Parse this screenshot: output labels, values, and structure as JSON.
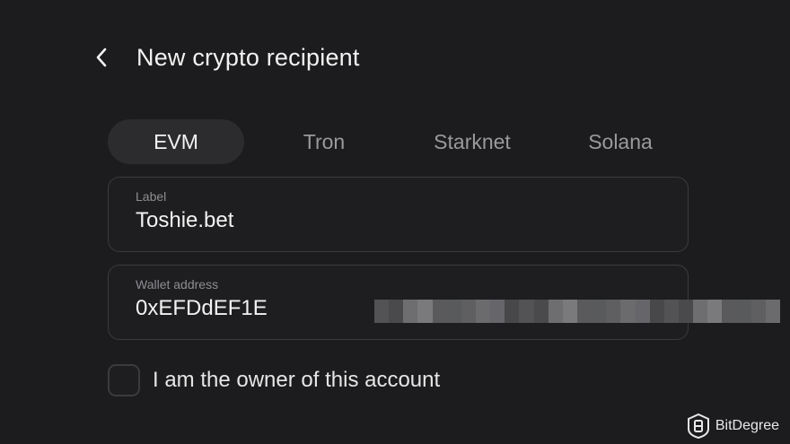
{
  "header": {
    "title": "New crypto recipient",
    "back_icon": "chevron-left-icon"
  },
  "tabs": [
    {
      "label": "EVM",
      "active": true
    },
    {
      "label": "Tron",
      "active": false
    },
    {
      "label": "Starknet",
      "active": false
    },
    {
      "label": "Solana",
      "active": false
    }
  ],
  "label_field": {
    "label": "Label",
    "value": "Toshie.bet"
  },
  "wallet_field": {
    "label": "Wallet address",
    "value": "0xEFDdEF1E"
  },
  "owner_checkbox": {
    "label": "I am the owner of this account",
    "checked": false
  },
  "watermark": {
    "text": "BitDegree",
    "icon": "bitdegree-logo-icon"
  },
  "colors": {
    "background": "#1c1c1e",
    "tab_active_bg": "#2c2c2e",
    "field_border": "#3b3b3e",
    "muted_text": "#8e8e92"
  }
}
